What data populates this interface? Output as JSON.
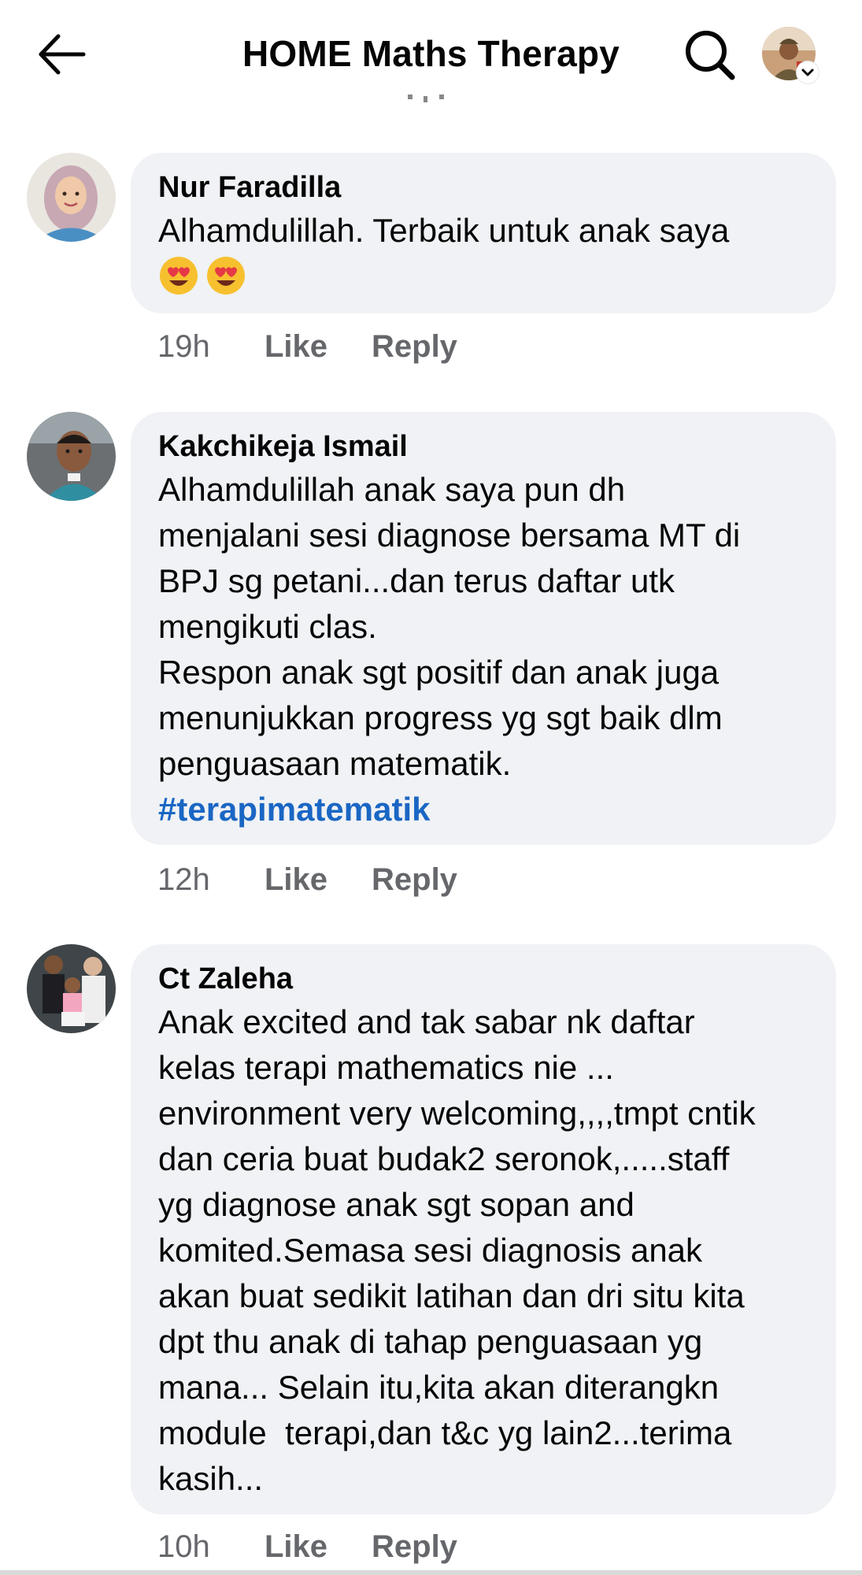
{
  "header": {
    "title": "HOME Maths Therapy",
    "back_icon": "arrow-left-icon",
    "search_icon": "search-icon",
    "profile_icon": "profile-avatar"
  },
  "colors": {
    "bubble": "#f0f2f5",
    "hashtag": "#1a66c4",
    "meta_text": "#65676b",
    "text": "#050505"
  },
  "comments": [
    {
      "author": "Nur Faradilla",
      "text": "Alhamdulillah. Terbaik untuk anak saya",
      "emoji": [
        "heart-eyes-emoji",
        "heart-eyes-emoji"
      ],
      "time": "19h",
      "like_label": "Like",
      "reply_label": "Reply"
    },
    {
      "author": "Kakchikeja Ismail",
      "text": "Alhamdulillah anak saya pun dh\nmenjalani sesi diagnose bersama MT di\nBPJ sg petani...dan terus daftar utk\nmengikuti clas.\nRespon anak sgt positif dan anak juga\nmenunjukkan progress yg sgt baik dlm\npenguasaan matematik.",
      "hashtag": "#terapimatematik",
      "time": "12h",
      "like_label": "Like",
      "reply_label": "Reply"
    },
    {
      "author": "Ct Zaleha",
      "text": "Anak excited and tak sabar nk daftar\nkelas terapi mathematics nie ...\nenvironment very welcoming,,,,tmpt cntik\ndan ceria buat budak2 seronok,.....staff\nyg diagnose anak sgt sopan and\nkomited.Semasa sesi diagnosis anak\nakan buat sedikit latihan dan dri situ kita\ndpt thu anak di tahap penguasaan yg\nmana... Selain itu,kita akan diterangkn\nmodule  terapi,dan t&c yg lain2...terima\nkasih...",
      "time": "10h",
      "like_label": "Like",
      "reply_label": "Reply"
    }
  ]
}
